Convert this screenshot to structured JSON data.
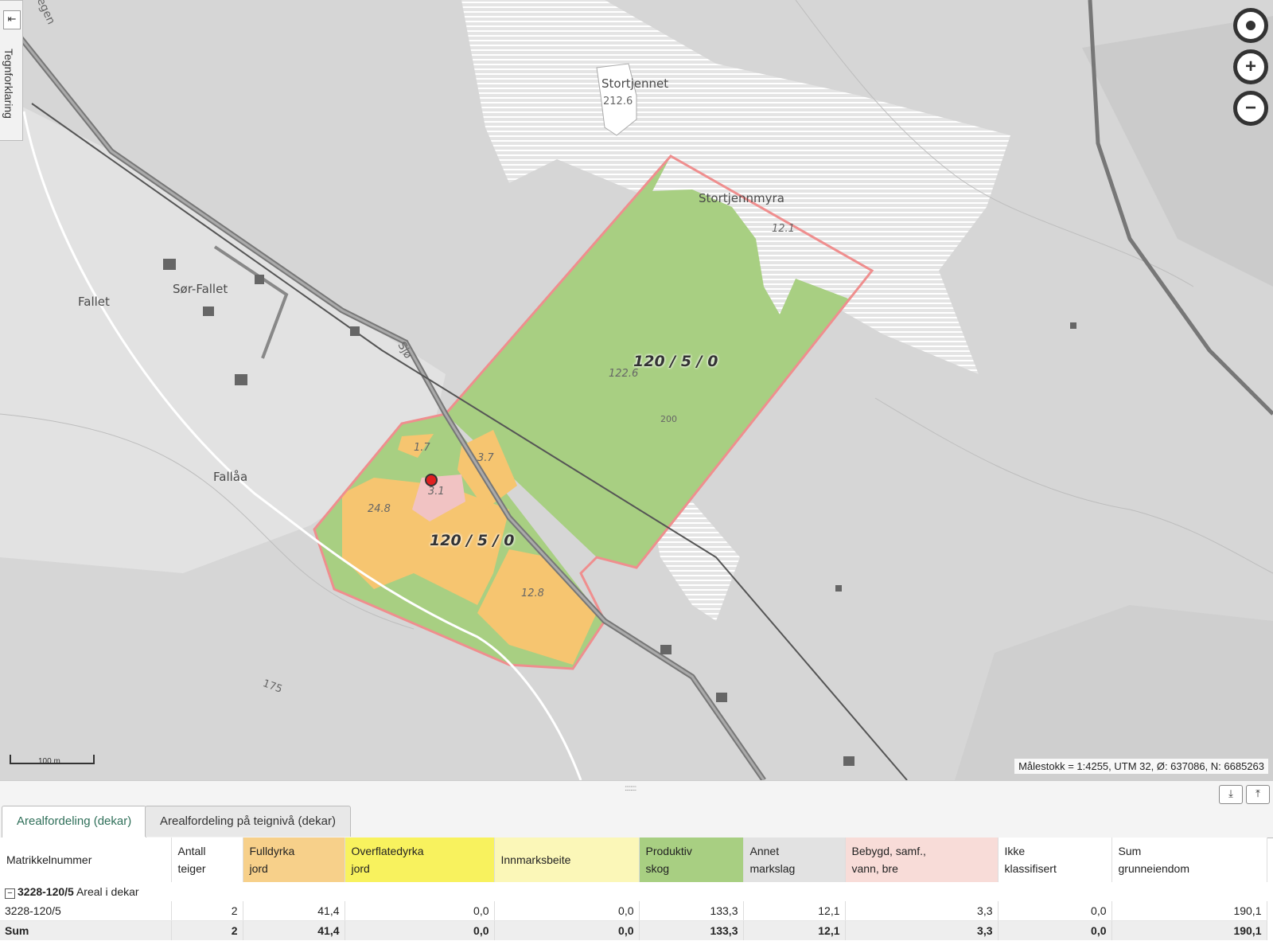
{
  "legend": {
    "label": "Tegnforklaring",
    "collapse_icon": "arrow-left-icon"
  },
  "map": {
    "places": [
      "Stortjennet",
      "Stortjennmyra",
      "Sør-Fallet",
      "Fallet",
      "Fallåa",
      "Sjø",
      "egen"
    ],
    "heights": [
      "212.6",
      "175",
      "200"
    ],
    "parcel_labels": [
      "120 / 5 / 0",
      "120 / 5 / 0"
    ],
    "area_labels": [
      "12.1",
      "122.6",
      "1.7",
      "3.7",
      "3.1",
      "24.8",
      "12.8"
    ],
    "colors": {
      "fulldyrka": "#f6c570",
      "produktiv_skog": "#a8cf82",
      "bebygd": "#f1c3c3",
      "boundary": "#ef8e8e",
      "marsh_hatch": "#ffffff"
    },
    "controls": {
      "locate_icon": "locate-icon",
      "zoom_in_icon": "zoom-in-icon",
      "zoom_out_icon": "zoom-out-icon"
    },
    "scale_label": "100 m",
    "coords": "Målestokk = 1:4255, UTM 32, Ø: 637086, N: 6685263"
  },
  "panel": {
    "grip": "::::::::",
    "collapse_icon": "download-arrow-icon",
    "expand_icon": "upload-arrow-icon",
    "tabs": [
      "Arealfordeling (dekar)",
      "Arealfordeling på teignivå (dekar)"
    ],
    "columns": [
      {
        "l1": "Matrikkelnummer",
        "l2": "",
        "color": "#ffffff"
      },
      {
        "l1": "Antall",
        "l2": "teiger",
        "color": "#ffffff"
      },
      {
        "l1": "Fulldyrka",
        "l2": "jord",
        "color": "#f7d08a"
      },
      {
        "l1": "Overflatedyrka",
        "l2": "jord",
        "color": "#f8f25e"
      },
      {
        "l1": "Innmarksbeite",
        "l2": "",
        "color": "#fbf7b8"
      },
      {
        "l1": "Produktiv",
        "l2": "skog",
        "color": "#a8cf82"
      },
      {
        "l1": "Annet",
        "l2": "markslag",
        "color": "#e2e2e2"
      },
      {
        "l1": "Bebygd, samf.,",
        "l2": "vann, bre",
        "color": "#f8dcd8"
      },
      {
        "l1": "Ikke",
        "l2": "klassifisert",
        "color": "#ffffff"
      },
      {
        "l1": "Sum",
        "l2": "grunneiendom",
        "color": "#ffffff"
      }
    ],
    "group": {
      "id": "3228-120/5",
      "label": "Areal i dekar",
      "expander": "−"
    },
    "rows": [
      [
        "3228-120/5",
        "2",
        "41,4",
        "0,0",
        "0,0",
        "133,3",
        "12,1",
        "3,3",
        "0,0",
        "190,1"
      ]
    ],
    "sum": [
      "Sum",
      "2",
      "41,4",
      "0,0",
      "0,0",
      "133,3",
      "12,1",
      "3,3",
      "0,0",
      "190,1"
    ]
  }
}
